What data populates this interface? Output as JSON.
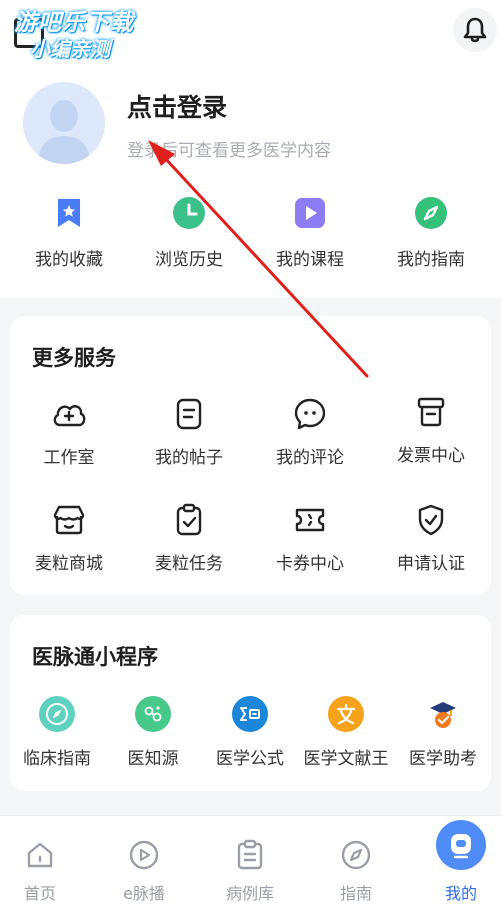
{
  "watermark": {
    "line1": "游吧乐下载",
    "line2": "小编亲测"
  },
  "header": {
    "scan_icon": "scan-icon",
    "bell_icon": "bell-icon"
  },
  "profile": {
    "title": "点击登录",
    "subtitle": "登录后可查看更多医学内容",
    "avatar_icon": "default-avatar-icon"
  },
  "quick_links": [
    {
      "label": "我的收藏",
      "icon": "bookmark-star-icon",
      "color": "#4a7cf6"
    },
    {
      "label": "浏览历史",
      "icon": "clock-icon",
      "color": "#3cc08a"
    },
    {
      "label": "我的课程",
      "icon": "play-icon",
      "color": "#8c7cf5"
    },
    {
      "label": "我的指南",
      "icon": "compass-icon",
      "color": "#36c17b"
    }
  ],
  "services": {
    "title": "更多服务",
    "items": [
      {
        "label": "工作室",
        "icon": "cloud-plus-icon"
      },
      {
        "label": "我的帖子",
        "icon": "document-icon"
      },
      {
        "label": "我的评论",
        "icon": "comment-icon"
      },
      {
        "label": "发票中心",
        "icon": "invoice-icon"
      },
      {
        "label": "麦粒商城",
        "icon": "shop-icon"
      },
      {
        "label": "麦粒任务",
        "icon": "task-clipboard-icon"
      },
      {
        "label": "卡券中心",
        "icon": "coupon-icon"
      },
      {
        "label": "申请认证",
        "icon": "shield-check-icon"
      }
    ]
  },
  "mini_programs": {
    "title": "医脉通小程序",
    "items": [
      {
        "label": "临床指南",
        "icon": "compass-circle-icon",
        "color": "#5fd2bf"
      },
      {
        "label": "医知源",
        "icon": "molecule-icon",
        "color": "#46c98a"
      },
      {
        "label": "医学公式",
        "icon": "formula-icon",
        "color": "#1c86d8"
      },
      {
        "label": "医学文献王",
        "icon": "literature-icon",
        "color": "#f7a21b"
      },
      {
        "label": "医学助考",
        "icon": "graduation-icon",
        "color": "#e8402f"
      }
    ]
  },
  "tabbar": {
    "items": [
      {
        "label": "首页",
        "icon": "home-icon",
        "active": false
      },
      {
        "label": "e脉播",
        "icon": "play-circle-icon",
        "active": false
      },
      {
        "label": "病例库",
        "icon": "clipboard-icon",
        "active": false
      },
      {
        "label": "指南",
        "icon": "compass-icon",
        "active": false
      },
      {
        "label": "我的",
        "icon": "profile-face-icon",
        "active": true
      }
    ],
    "active_color": "#2f6df6",
    "inactive_color": "#9a9ea6"
  },
  "annotation": {
    "arrow_color": "#e0201a"
  }
}
